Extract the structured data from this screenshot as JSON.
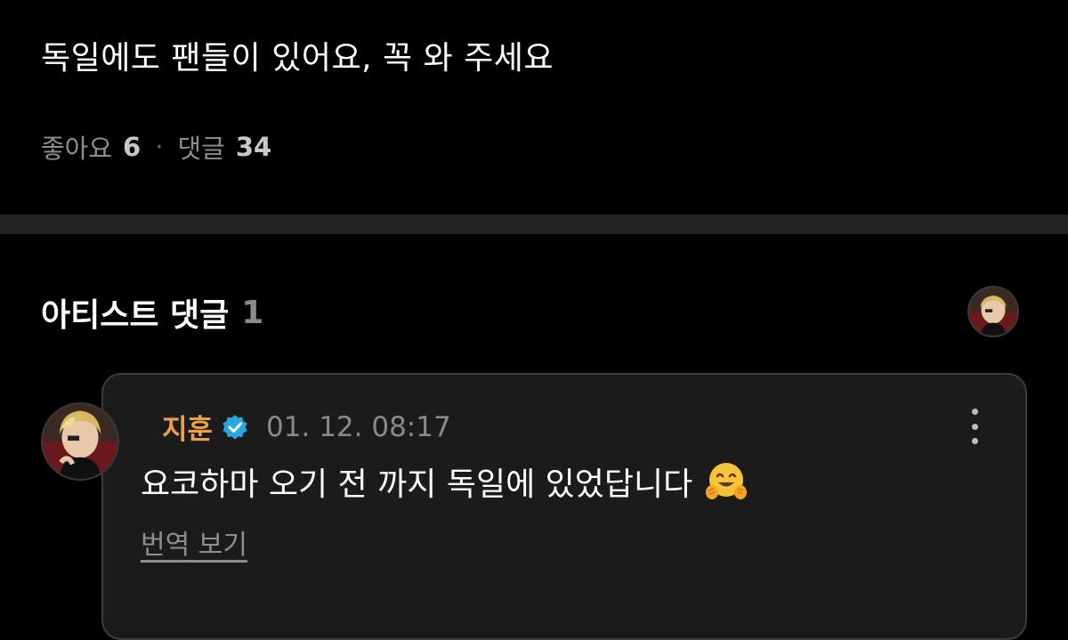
{
  "post": {
    "text": "독일에도 팬들이 있어요, 꼭 와 주세요",
    "likes_label": "좋아요",
    "likes_count": "6",
    "separator": "·",
    "comments_label": "댓글",
    "comments_count": "34"
  },
  "artist_comments": {
    "title": "아티스트 댓글",
    "count": "1"
  },
  "comment": {
    "author": "지훈",
    "verified": true,
    "timestamp": "01. 12. 08:17",
    "body": "요코하마 오기 전 까지 독일에 있었답니다",
    "emoji": "hugging-face",
    "translate_label": "번역 보기"
  },
  "colors": {
    "background": "#000000",
    "divider": "#222222",
    "card_background": "#1b1b1b",
    "author_name": "#e8a04a",
    "verified_badge": "#27a8e0",
    "muted_text": "#8e8e8e"
  }
}
